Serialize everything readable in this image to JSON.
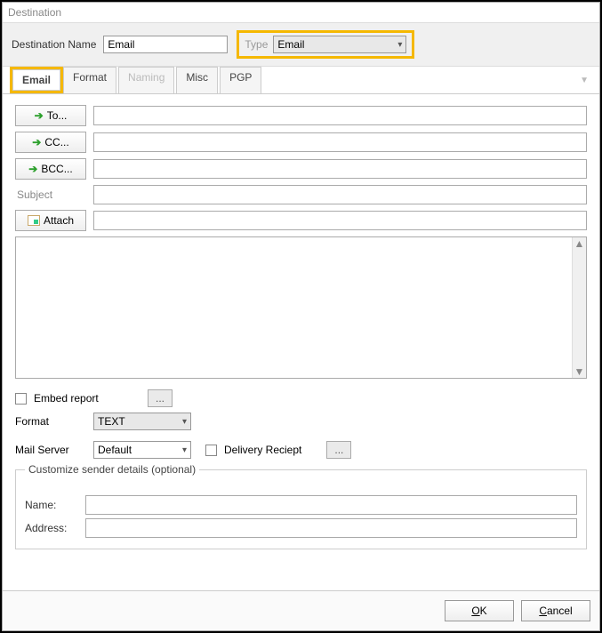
{
  "title": "Destination",
  "header": {
    "dest_label": "Destination Name",
    "dest_value": "Email",
    "type_label": "Type",
    "type_value": "Email"
  },
  "tabs": {
    "email": "Email",
    "format": "Format",
    "naming": "Naming",
    "misc": "Misc",
    "pgp": "PGP"
  },
  "buttons": {
    "to": "To...",
    "cc": "CC...",
    "bcc": "BCC...",
    "attach": "Attach"
  },
  "labels": {
    "subject": "Subject",
    "embed": "Embed report",
    "format": "Format",
    "mail_server": "Mail Server",
    "delivery": "Delivery Reciept",
    "customize": "Customize sender details (optional)",
    "name": "Name:",
    "address": "Address:",
    "ellipsis": "..."
  },
  "values": {
    "format_select": "TEXT",
    "mail_server_select": "Default",
    "to": "",
    "cc": "",
    "bcc": "",
    "subject": "",
    "attach": "",
    "body": "",
    "sender_name": "",
    "sender_address": ""
  },
  "footer": {
    "ok": "OK",
    "cancel": "Cancel"
  }
}
